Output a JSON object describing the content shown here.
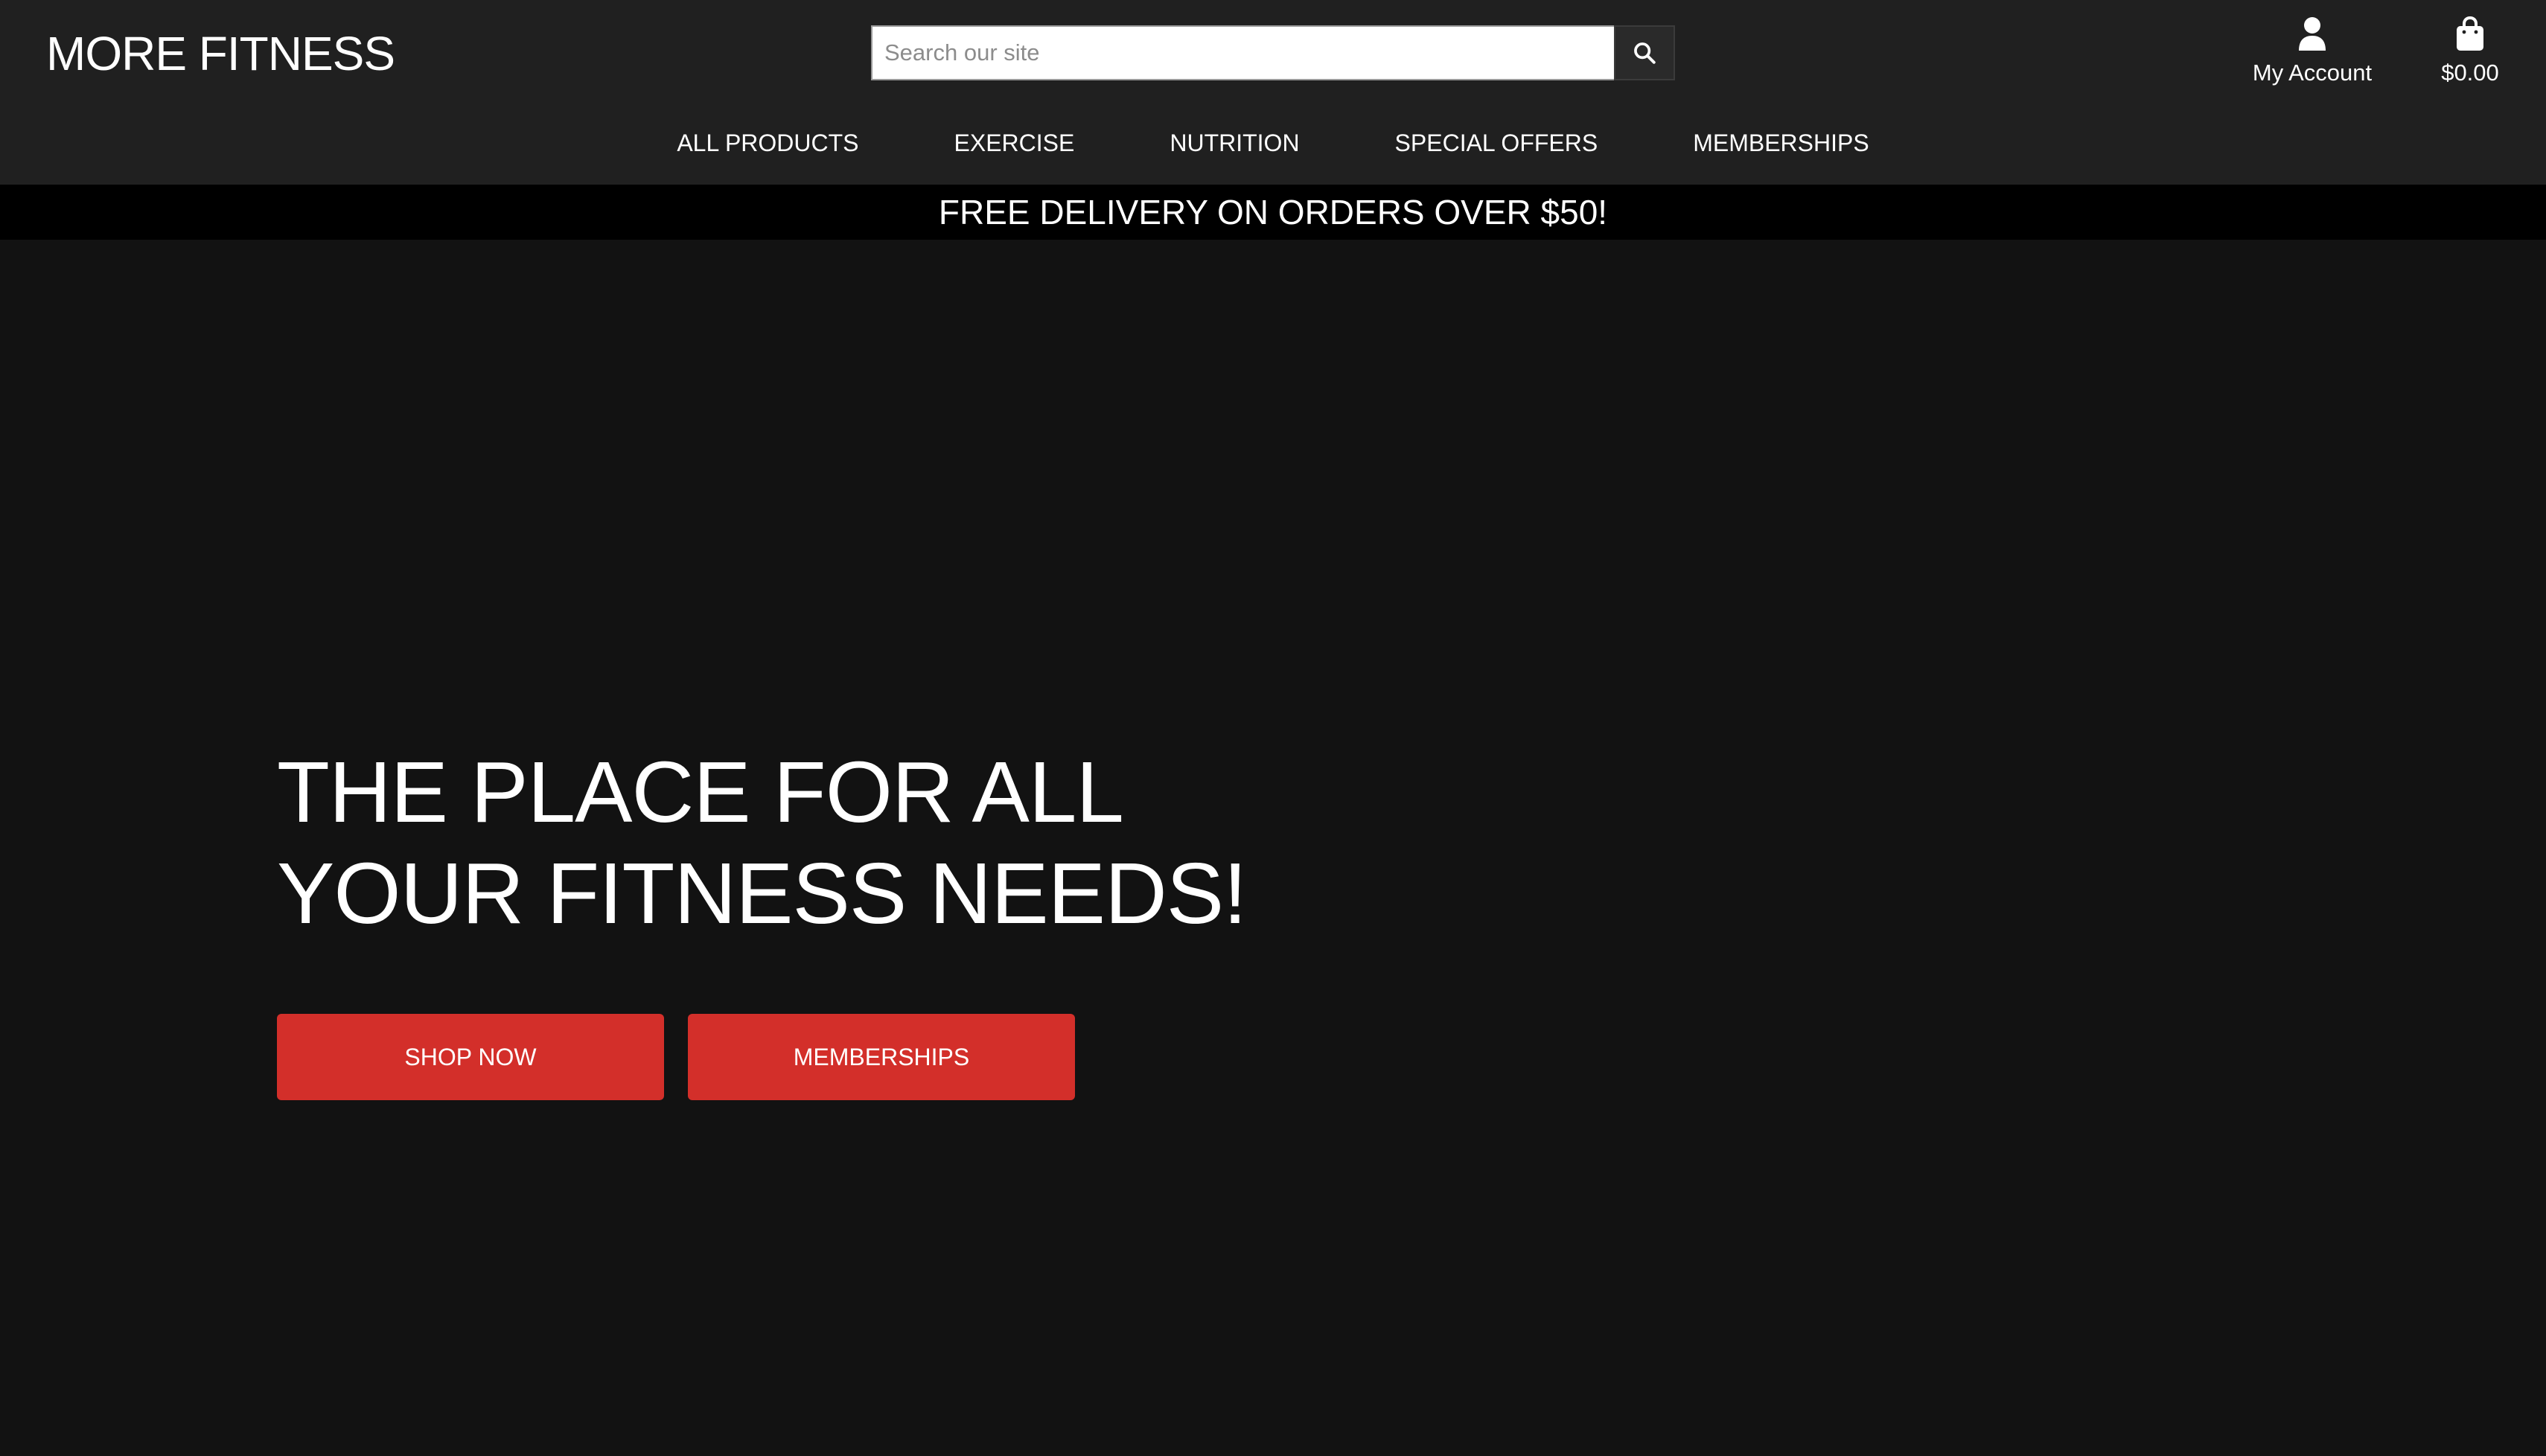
{
  "header": {
    "logo": "MORE FITNESS",
    "search": {
      "placeholder": "Search our site",
      "value": ""
    },
    "account_label": "My Account",
    "cart_total": "$0.00",
    "icons": {
      "search": "search-icon",
      "account": "user-icon",
      "cart": "shopping-bag-icon"
    }
  },
  "nav": {
    "items": [
      {
        "label": "ALL PRODUCTS"
      },
      {
        "label": "EXERCISE"
      },
      {
        "label": "NUTRITION"
      },
      {
        "label": "SPECIAL OFFERS"
      },
      {
        "label": "MEMBERSHIPS"
      }
    ]
  },
  "banner": {
    "text": "FREE DELIVERY ON ORDERS OVER $50!"
  },
  "hero": {
    "title_line_1": "THE PLACE FOR ALL",
    "title_line_2": "YOUR FITNESS NEEDS!",
    "buttons": {
      "shop_now": "SHOP NOW",
      "memberships": "MEMBERSHIPS"
    }
  },
  "colors": {
    "header_bg": "#202020",
    "banner_bg": "#000000",
    "hero_bg": "#121212",
    "accent": "#d32f2a",
    "text": "#ffffff"
  }
}
